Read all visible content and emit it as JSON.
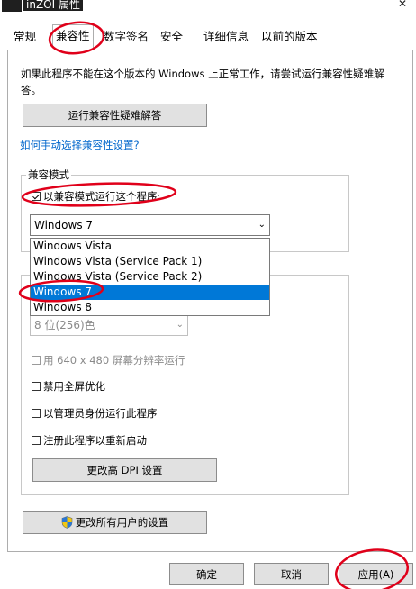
{
  "window": {
    "title": "inZOI 属性",
    "close_glyph": "✕"
  },
  "tabs": [
    {
      "label": "常规"
    },
    {
      "label": "兼容性",
      "active": true
    },
    {
      "label": "数字签名"
    },
    {
      "label": "安全"
    },
    {
      "label": "详细信息"
    },
    {
      "label": "以前的版本"
    }
  ],
  "compat": {
    "description": "如果此程序不能在这个版本的 Windows 上正常工作，请尝试运行兼容性疑难解答。",
    "troubleshoot_button": "运行兼容性疑难解答",
    "manual_link": "如何手动选择兼容性设置?",
    "mode_group_label": "兼容模式",
    "mode_checkbox_label": "以兼容模式运行这个程序:",
    "mode_checked": true,
    "selected_os": "Windows 7",
    "os_options": [
      "Windows Vista",
      "Windows Vista (Service Pack 1)",
      "Windows Vista (Service Pack 2)",
      "Windows 7",
      "Windows 8"
    ],
    "color_select_value": "8 位(256)色",
    "res_checkbox_label": "用 640 x 480 屏幕分辨率运行",
    "fullscreen_checkbox_label": "禁用全屏优化",
    "admin_checkbox_label": "以管理员身份运行此程序",
    "restart_checkbox_label": "注册此程序以重新启动",
    "dpi_button": "更改高 DPI 设置",
    "all_users_button": "更改所有用户的设置"
  },
  "footer": {
    "ok": "确定",
    "cancel": "取消",
    "apply": "应用(A)"
  },
  "colors": {
    "selection": "#0078d7",
    "link": "#0066cc",
    "annotation": "#e0001a",
    "button_face": "#e1e1e1"
  }
}
